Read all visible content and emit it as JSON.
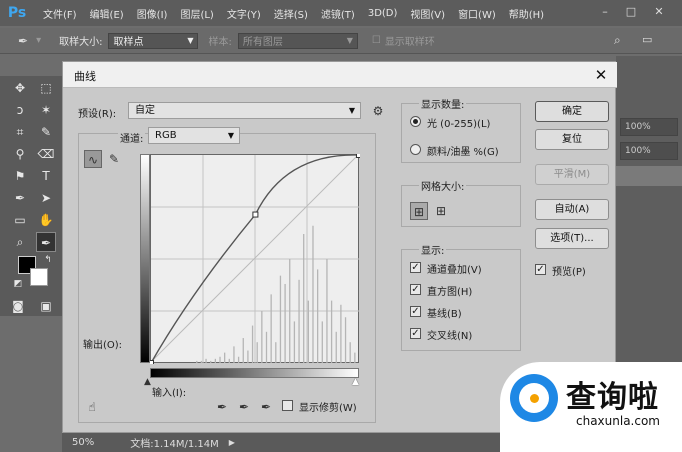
{
  "app": {
    "logo": "Ps",
    "menus": [
      "文件(F)",
      "编辑(E)",
      "图像(I)",
      "图层(L)",
      "文字(Y)",
      "选择(S)",
      "滤镜(T)",
      "3D(D)",
      "视图(V)",
      "窗口(W)",
      "帮助(H)"
    ]
  },
  "options": {
    "sample_size_label": "取样大小:",
    "sample_size_value": "取样点",
    "sample_label": "样本:",
    "sample_value": "所有图层",
    "show_ring_label": "显示取样环"
  },
  "right_panel": {
    "zoom_a": "100%",
    "zoom_b": "100%"
  },
  "status": {
    "zoom": "50%",
    "doc": "文档:1.14M/1.14M"
  },
  "dialog": {
    "title": "曲线",
    "preset_label": "预设(R):",
    "preset_value": "自定",
    "channel_label": "通道:",
    "channel_value": "RGB",
    "output_label": "输出(O):",
    "input_label": "输入(I):",
    "show_clipping_label": "显示修剪(W)",
    "show_amount": {
      "title": "显示数量:",
      "light": "光 (0-255)(L)",
      "pigment": "颜料/油墨 %(G)"
    },
    "grid_size": {
      "title": "网格大小:"
    },
    "display": {
      "title": "显示:",
      "channel_overlay": "通道叠加(V)",
      "histogram": "直方图(H)",
      "baseline": "基线(B)",
      "intersection": "交叉线(N)"
    },
    "buttons": {
      "ok": "确定",
      "reset": "复位",
      "smooth": "平滑(M)",
      "auto": "自动(A)",
      "options": "选项(T)..."
    },
    "preview_label": "预览(P)"
  },
  "curve": {
    "points": [
      [
        0,
        0
      ],
      [
        128,
        182
      ],
      [
        255,
        255
      ]
    ]
  },
  "histogram": {
    "bins": [
      0.01,
      0.01,
      0.02,
      0.01,
      0.02,
      0.03,
      0.05,
      0.02,
      0.08,
      0.03,
      0.12,
      0.06,
      0.18,
      0.1,
      0.25,
      0.15,
      0.33,
      0.1,
      0.42,
      0.38,
      0.5,
      0.2,
      0.4,
      0.62,
      0.3,
      0.66,
      0.45,
      0.2,
      0.5,
      0.3,
      0.15,
      0.28,
      0.22,
      0.1,
      0.05
    ]
  },
  "watermark": {
    "text": "查询啦",
    "url": "chaxunla.com"
  }
}
